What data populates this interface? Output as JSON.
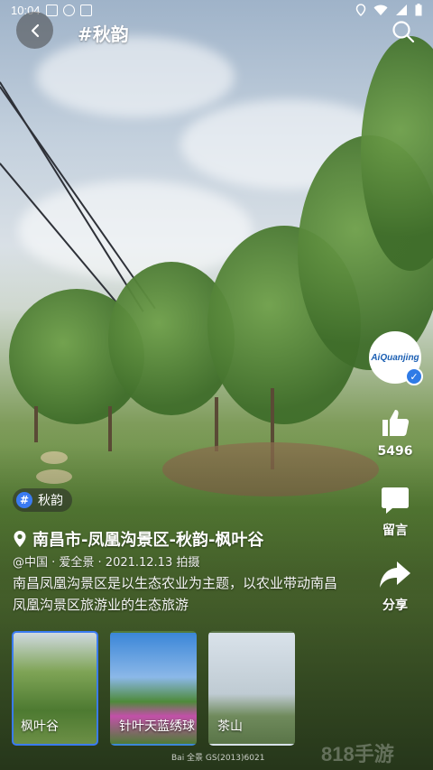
{
  "status_bar": {
    "time": "10:04",
    "icons_left": [
      "A",
      "badge-icon",
      "app-icon"
    ],
    "icons_right": [
      "location-icon",
      "wifi-icon",
      "signal-icon",
      "battery-icon"
    ]
  },
  "header": {
    "title": "#秋韵"
  },
  "author": {
    "name": "AiQuanjing",
    "verified": true
  },
  "actions": {
    "like_count": "5496",
    "comment_label": "留言",
    "share_label": "分享"
  },
  "tag": {
    "hash": "#",
    "label": "秋韵"
  },
  "info": {
    "location": "南昌市-凤凰沟景区-秋韵-枫叶谷",
    "meta": "@中国 · 爱全景 · 2021.12.13 拍摄",
    "description": "南昌凤凰沟景区是以生态农业为主题，以农业带动南昌凤凰沟景区旅游业的生态旅游"
  },
  "thumbnails": [
    {
      "caption": "枫叶谷",
      "active": true
    },
    {
      "caption": "针叶天蓝绣球",
      "active": false
    },
    {
      "caption": "茶山",
      "active": false
    }
  ],
  "watermark": "Bai 全景 GS(2013)6021",
  "brand_faint": "818手游"
}
